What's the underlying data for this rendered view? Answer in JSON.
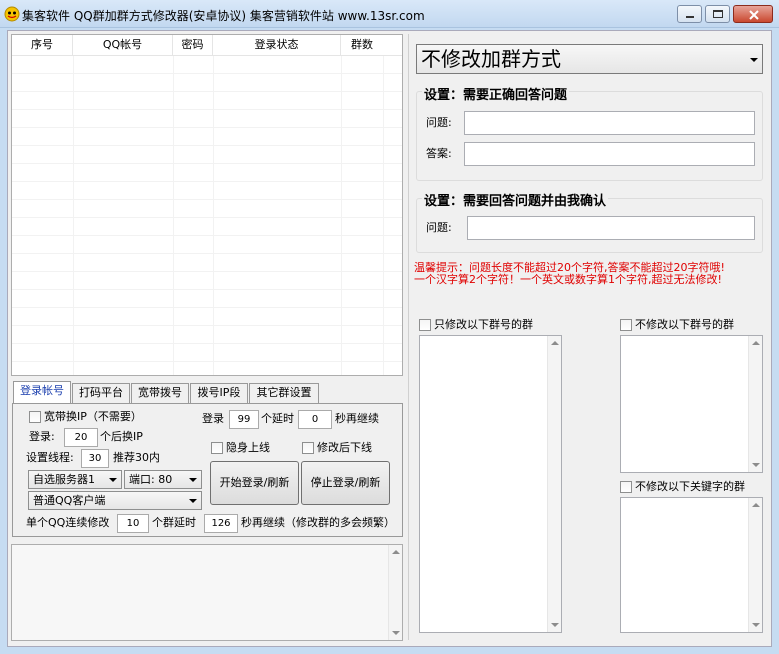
{
  "window": {
    "title": "集客软件  QQ群加群方式修改器(安卓协议)  集客营销软件站  www.13sr.com"
  },
  "account_table": {
    "columns": [
      "序号",
      "QQ帐号",
      "密码",
      "登录状态",
      "群数"
    ]
  },
  "tabs": [
    {
      "label": "登录帐号",
      "active": true
    },
    {
      "label": "打码平台"
    },
    {
      "label": "宽带拨号"
    },
    {
      "label": "拨号IP段"
    },
    {
      "label": "其它群设置"
    }
  ],
  "login_tab": {
    "broadband_ip_label": "宽带换IP（不需要）",
    "login_prefix": "登录",
    "login_count": "99",
    "login_delay_label": "个延时",
    "login_delay": "0",
    "login_delay_suffix": "秒再继续",
    "switch_prefix": "登录:",
    "switch_count": "20",
    "switch_suffix": "个后换IP",
    "thread_label": "设置线程:",
    "thread_count": "30",
    "thread_hint": "推荐30内",
    "stealth_label": "隐身上线",
    "logout_after_label": "修改后下线",
    "server_select": "自选服务器1",
    "port_select": "端口: 80",
    "client_select": "普通QQ客户端",
    "start_button": "开始登录/刷新",
    "stop_button": "停止登录/刷新",
    "per_qq_prefix": "单个QQ连续修改",
    "per_qq_count": "10",
    "per_qq_mid": "个群延时",
    "per_qq_delay": "126",
    "per_qq_suffix": "秒再继续（修改群的多会频繁）"
  },
  "join_mode": {
    "selected": "不修改加群方式"
  },
  "setting1": {
    "title": "设置：需要正确回答问题",
    "question_label": "问题:",
    "answer_label": "答案:",
    "question_value": "",
    "answer_value": ""
  },
  "setting2": {
    "title": "设置：需要回答问题并由我确认",
    "question_label": "问题:",
    "question_value": ""
  },
  "warning": {
    "line1": "温馨提示：问题长度不能超过20个字符,答案不能超过20字符哦!",
    "line2": "一个汉字算2个字符！一个英文或数字算1个字符,超过无法修改!"
  },
  "lists": {
    "only_modify_label": "只修改以下群号的群",
    "exclude_label": "不修改以下群号的群",
    "exclude_keyword_label": "不修改以下关键字的群"
  },
  "colors": {
    "accent_tab_text": "#1b3fae",
    "warning_text": "#e00000",
    "window_frame": "#c6dcf2"
  }
}
